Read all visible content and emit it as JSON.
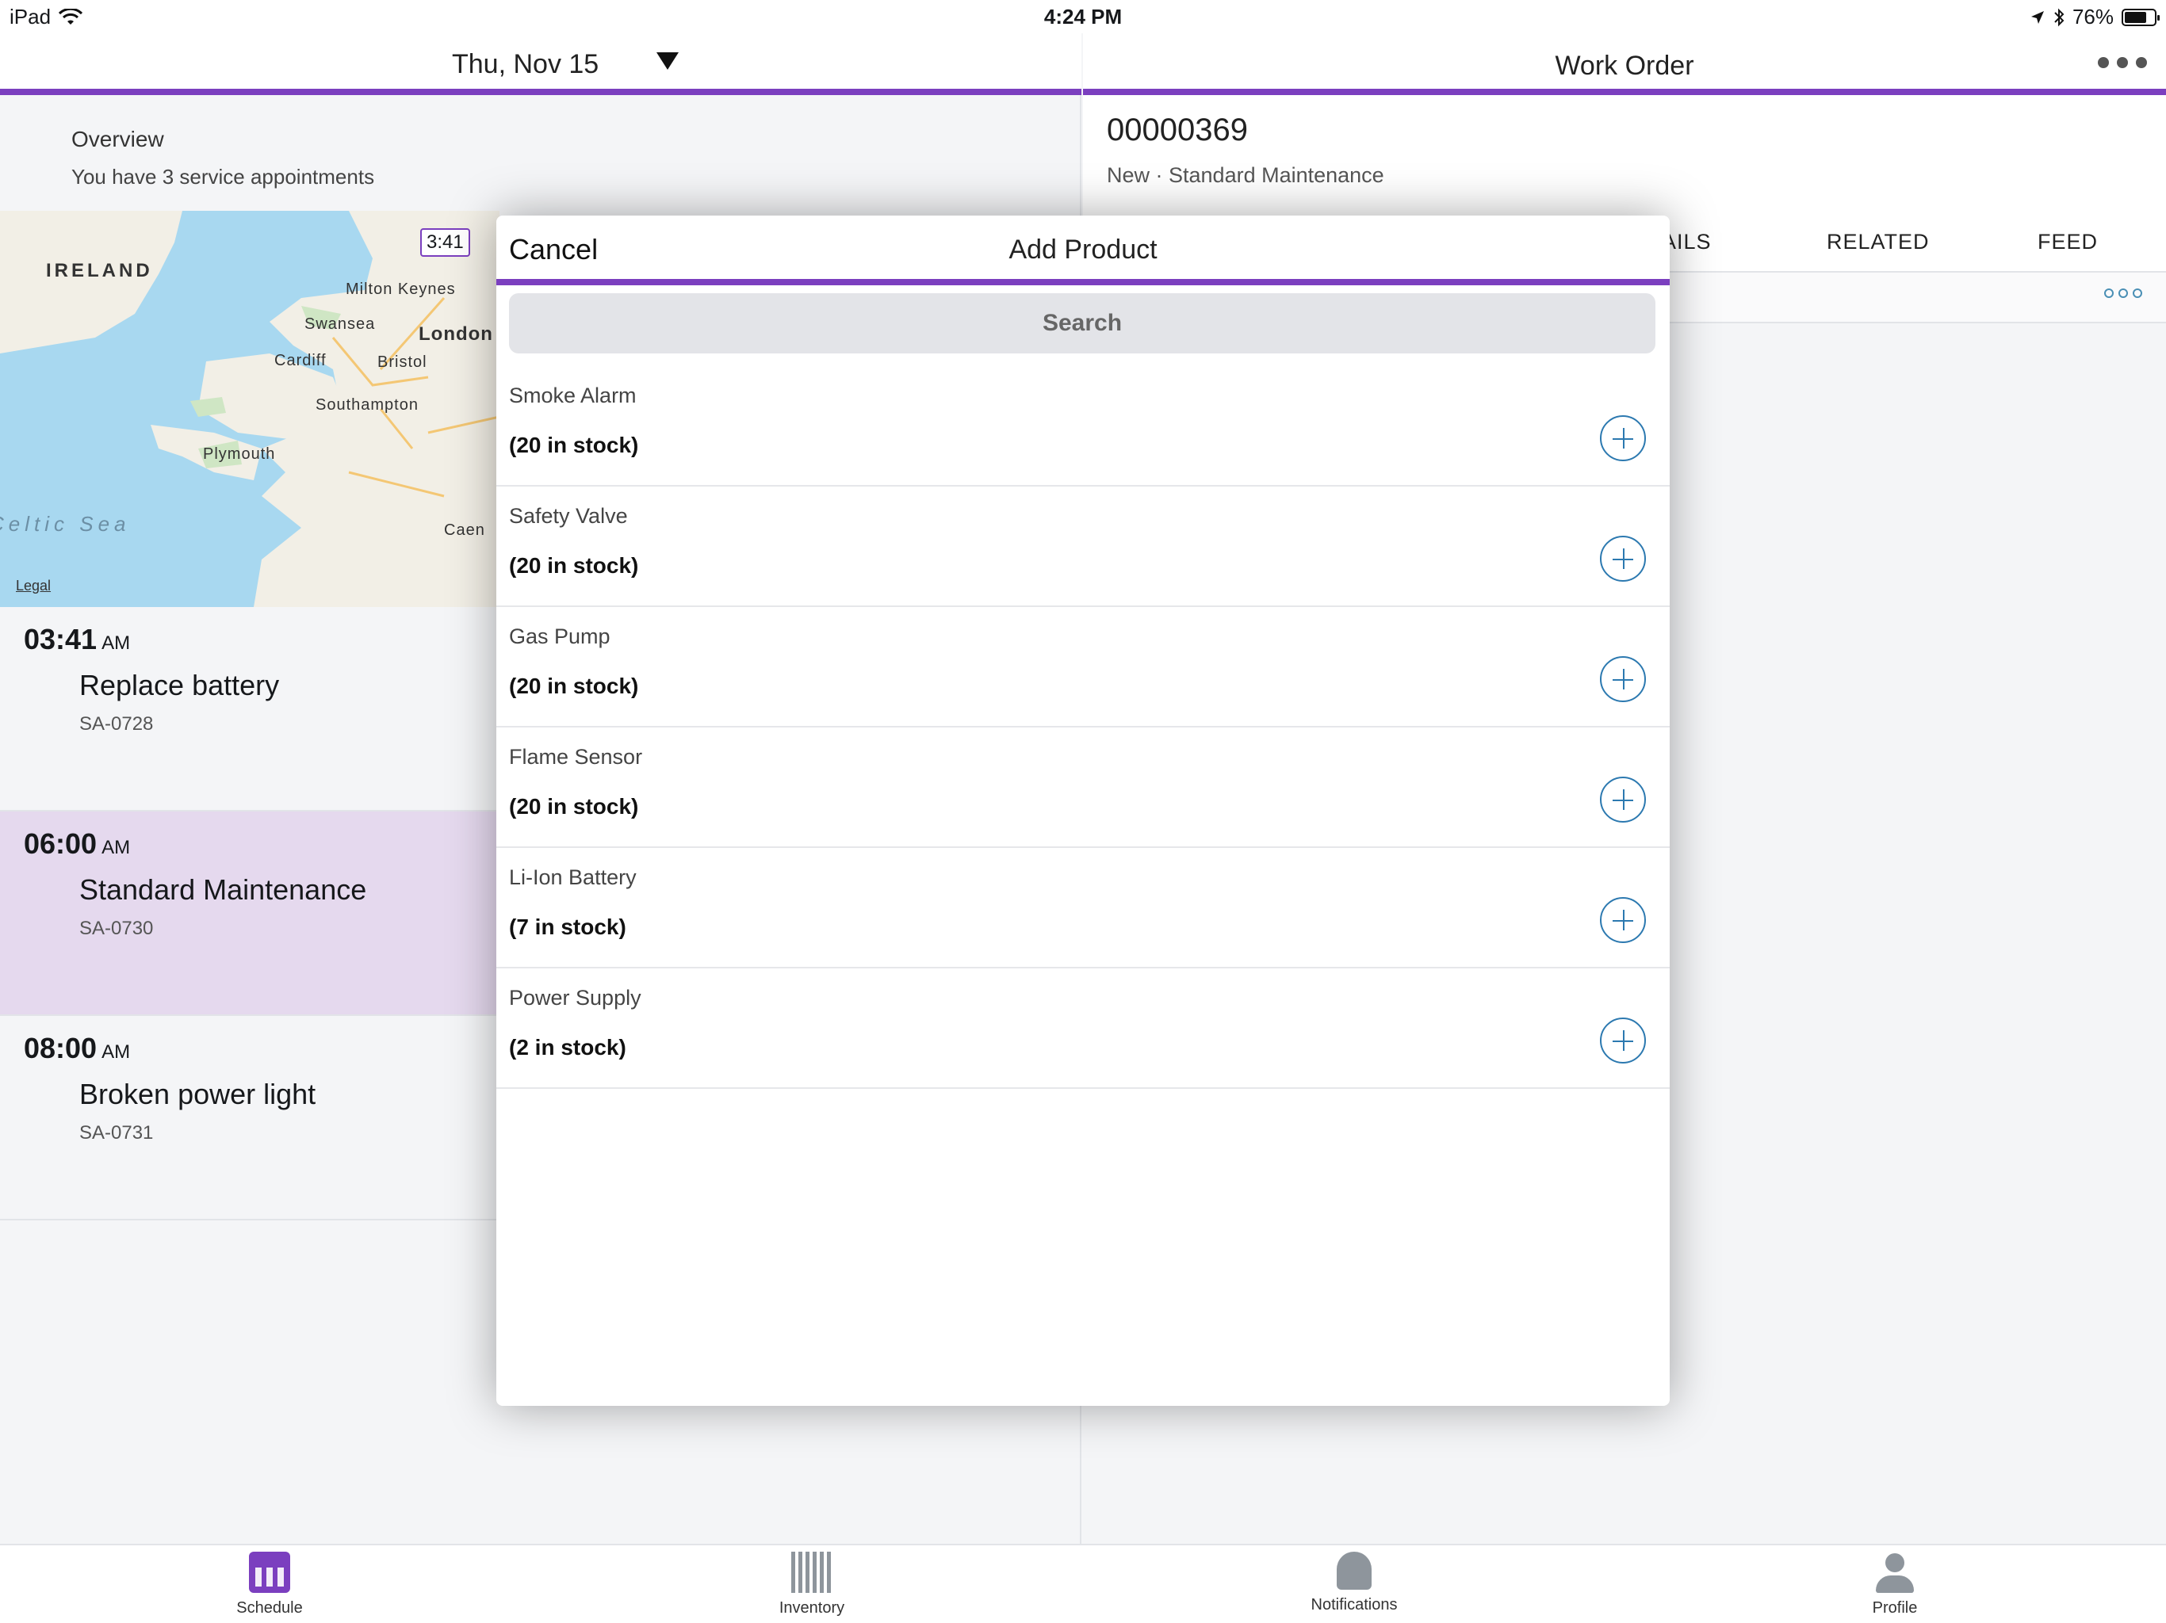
{
  "status_bar": {
    "device": "iPad",
    "time": "4:24 PM",
    "battery": "76%",
    "battery_level": 0.76
  },
  "left": {
    "date": "Thu, Nov 15",
    "overview_title": "Overview",
    "overview_subtitle": "You have 3 service appointments",
    "map": {
      "labels": {
        "ireland": "IRELAND",
        "milton_keynes": "Milton Keynes",
        "swansea": "Swansea",
        "london": "London",
        "cardiff": "Cardiff",
        "bristol": "Bristol",
        "southampton": "Southampton",
        "plymouth": "Plymouth",
        "celtic_sea": "Celtic Sea",
        "caen": "Caen"
      },
      "callout": "3:41",
      "legal": "Legal"
    },
    "appointments": [
      {
        "time": "03:41",
        "ampm": "AM",
        "title": "Replace battery",
        "id": "SA-0728"
      },
      {
        "time": "06:00",
        "ampm": "AM",
        "title": "Standard Maintenance",
        "id": "SA-0730"
      },
      {
        "time": "08:00",
        "ampm": "AM",
        "title": "Broken power light",
        "id": "SA-0731"
      }
    ]
  },
  "right": {
    "title": "Work Order",
    "number": "00000369",
    "status": "New  ·  Standard Maintenance",
    "tabs": [
      "AILS",
      "RELATED",
      "FEED"
    ]
  },
  "modal": {
    "cancel": "Cancel",
    "title": "Add Product",
    "search_placeholder": "Search",
    "products": [
      {
        "name": "Smoke Alarm",
        "stock": "(20 in stock)"
      },
      {
        "name": "Safety Valve",
        "stock": "(20 in stock)"
      },
      {
        "name": "Gas Pump",
        "stock": "(20 in stock)"
      },
      {
        "name": "Flame Sensor",
        "stock": "(20 in stock)"
      },
      {
        "name": "Li-Ion Battery",
        "stock": "(7 in stock)"
      },
      {
        "name": "Power Supply",
        "stock": "(2 in stock)"
      }
    ]
  },
  "tabbar": {
    "schedule": "Schedule",
    "inventory": "Inventory",
    "notifications": "Notifications",
    "profile": "Profile"
  },
  "colors": {
    "accent": "#7b3fbf",
    "selected_row": "#e5d9ee",
    "link": "#2c79b0"
  }
}
